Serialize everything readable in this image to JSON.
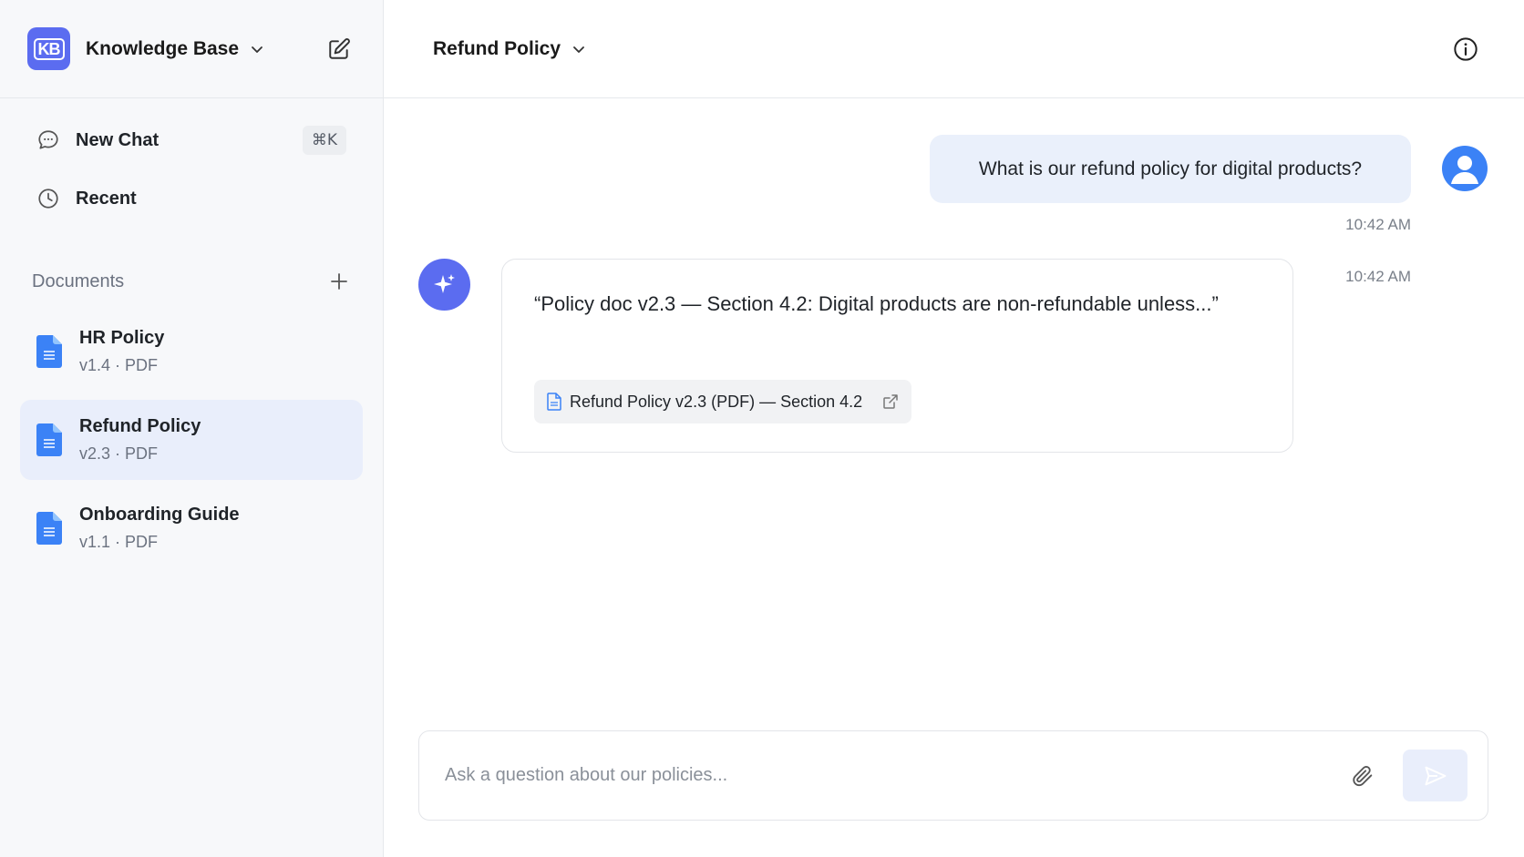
{
  "sidebar": {
    "logo_text": "KB",
    "workspace_title": "Knowledge Base",
    "nav": [
      {
        "label": "New Chat",
        "shortcut": "⌘K",
        "icon": "chat-bubble-icon"
      },
      {
        "label": "Recent",
        "icon": "clock-icon"
      }
    ],
    "documents_label": "Documents",
    "documents": [
      {
        "name": "HR Policy",
        "meta": "v1.4 · PDF",
        "active": false
      },
      {
        "name": "Refund Policy",
        "meta": "v2.3 · PDF",
        "active": true
      },
      {
        "name": "Onboarding Guide",
        "meta": "v1.1 · PDF",
        "active": false
      }
    ]
  },
  "header": {
    "title": "Refund Policy"
  },
  "conversation": {
    "user_message": "What is our refund policy for digital products?",
    "user_time": "10:42 AM",
    "bot_message": "“Policy doc v2.3 — Section 4.2: Digital products are non-refundable unless...”",
    "bot_time": "10:42 AM",
    "citation": "Refund Policy v2.3 (PDF) — Section 4.2"
  },
  "composer": {
    "placeholder": "Ask a question about our policies..."
  },
  "colors": {
    "accent": "#5b6cf0",
    "doc_blue": "#3b82f6",
    "active_bg": "#e9eefb"
  }
}
